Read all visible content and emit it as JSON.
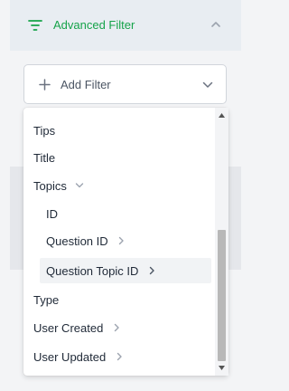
{
  "header": {
    "title": "Advanced Filter",
    "accent_color": "#16a34a",
    "icons": {
      "filter": "filter-icon",
      "collapse": "chevron-up-icon"
    }
  },
  "add_filter": {
    "label": "Add Filter",
    "icons": {
      "plus": "plus-icon",
      "dropdown": "chevron-down-icon"
    }
  },
  "menu": {
    "items": [
      {
        "label": "Tips"
      },
      {
        "label": "Title"
      },
      {
        "label": "Topics",
        "expanded": true
      },
      {
        "label": "ID"
      },
      {
        "label": "Question ID",
        "has_submenu": true
      },
      {
        "label": "Question Topic ID",
        "has_submenu": true,
        "highlighted": true
      },
      {
        "label": "Type"
      },
      {
        "label": "User Created",
        "has_submenu": true
      },
      {
        "label": "User Updated",
        "has_submenu": true
      }
    ]
  },
  "scrollbar": {
    "position": 0.62
  }
}
